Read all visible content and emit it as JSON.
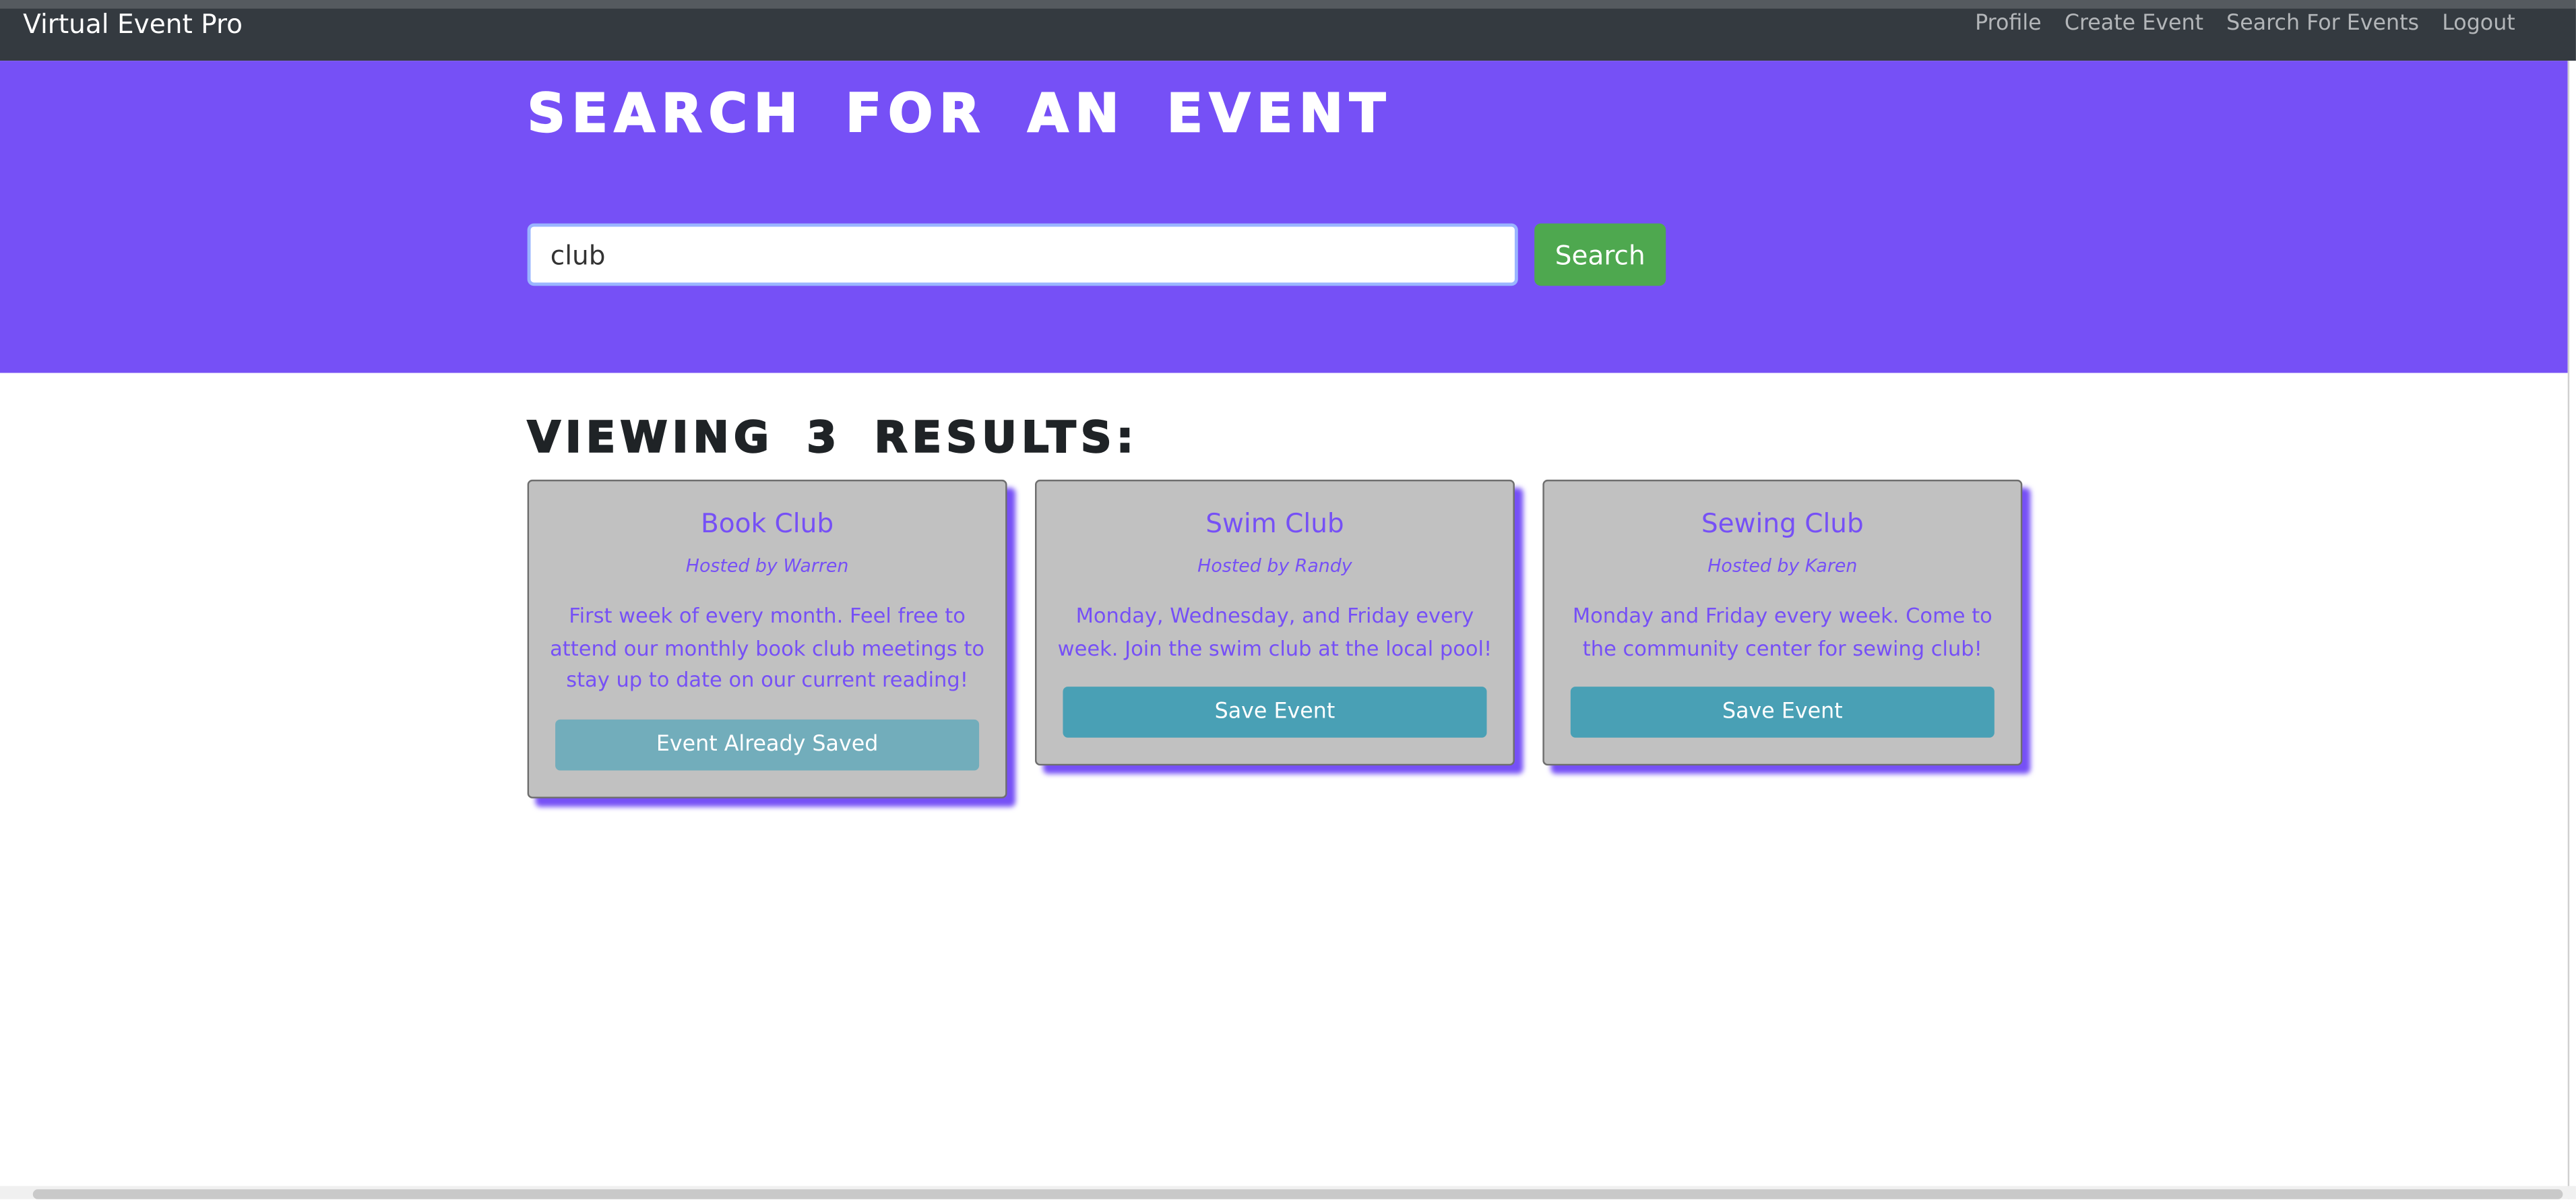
{
  "navbar": {
    "brand": "Virtual Event Pro",
    "links": [
      "Profile",
      "Create Event",
      "Search For Events",
      "Logout"
    ]
  },
  "hero": {
    "title": "SEARCH FOR AN EVENT",
    "search_value": "club",
    "search_button": "Search"
  },
  "results": {
    "title": "VIEWING 3 RESULTS:",
    "cards": [
      {
        "title": "Book Club",
        "host": "Hosted by Warren",
        "description": "First week of every month. Feel free to attend our monthly book club meetings to stay up to date on our current reading!",
        "button": "Event Already Saved"
      },
      {
        "title": "Swim Club",
        "host": "Hosted by Randy",
        "description": "Monday, Wednesday, and Friday every week. Join the swim club at the local pool!",
        "button": "Save Event"
      },
      {
        "title": "Sewing Club",
        "host": "Hosted by Karen",
        "description": "Monday and Friday every week. Come to the community center for sewing club!",
        "button": "Save Event"
      }
    ]
  },
  "colors": {
    "navbar": "#343a40",
    "hero": "#7650f6",
    "search_button": "#4ea84f",
    "card_background": "#c1c1c1",
    "save_button": "#49a0b5",
    "saved_button": "#72adbb"
  }
}
